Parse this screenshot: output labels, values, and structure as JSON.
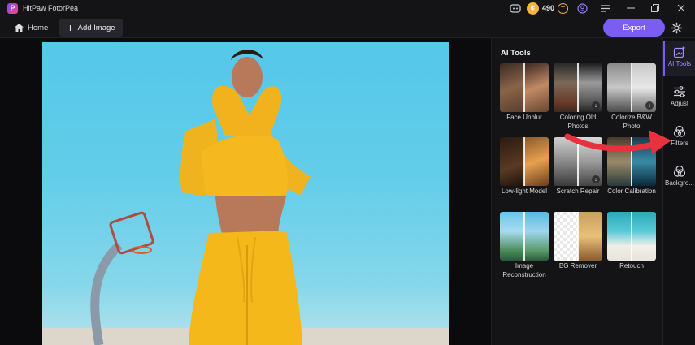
{
  "app": {
    "title": "HitPaw FotorPea",
    "logo_letter": "P"
  },
  "titlebar": {
    "coins": "490",
    "icons": [
      "discord-icon",
      "coin-icon",
      "add-coins-icon",
      "account-icon",
      "menu-icon",
      "minimize-icon",
      "restore-icon",
      "close-icon"
    ]
  },
  "toolbar": {
    "home_label": "Home",
    "add_image_label": "Add Image",
    "export_label": "Export"
  },
  "panel": {
    "title": "AI Tools",
    "tools": [
      {
        "label": "Face Unblur"
      },
      {
        "label": "Coloring Old Photos"
      },
      {
        "label": "Colorize B&W Photo"
      },
      {
        "label": "Low-light Model"
      },
      {
        "label": "Scratch Repair"
      },
      {
        "label": "Color Calibration"
      },
      {
        "label": "Image Reconstruction"
      },
      {
        "label": "BG Remover"
      },
      {
        "label": "Retouch"
      }
    ]
  },
  "rail": {
    "items": [
      {
        "label": "AI Tools",
        "icon": "ai-tools-icon"
      },
      {
        "label": "Adjust",
        "icon": "adjust-sliders-icon"
      },
      {
        "label": "Filters",
        "icon": "filters-icon"
      },
      {
        "label": "Backgro...",
        "icon": "background-icon"
      }
    ]
  },
  "colors": {
    "accent": "#7b5cf5",
    "arrow": "#e8313f",
    "coin": "#f2b43a"
  }
}
